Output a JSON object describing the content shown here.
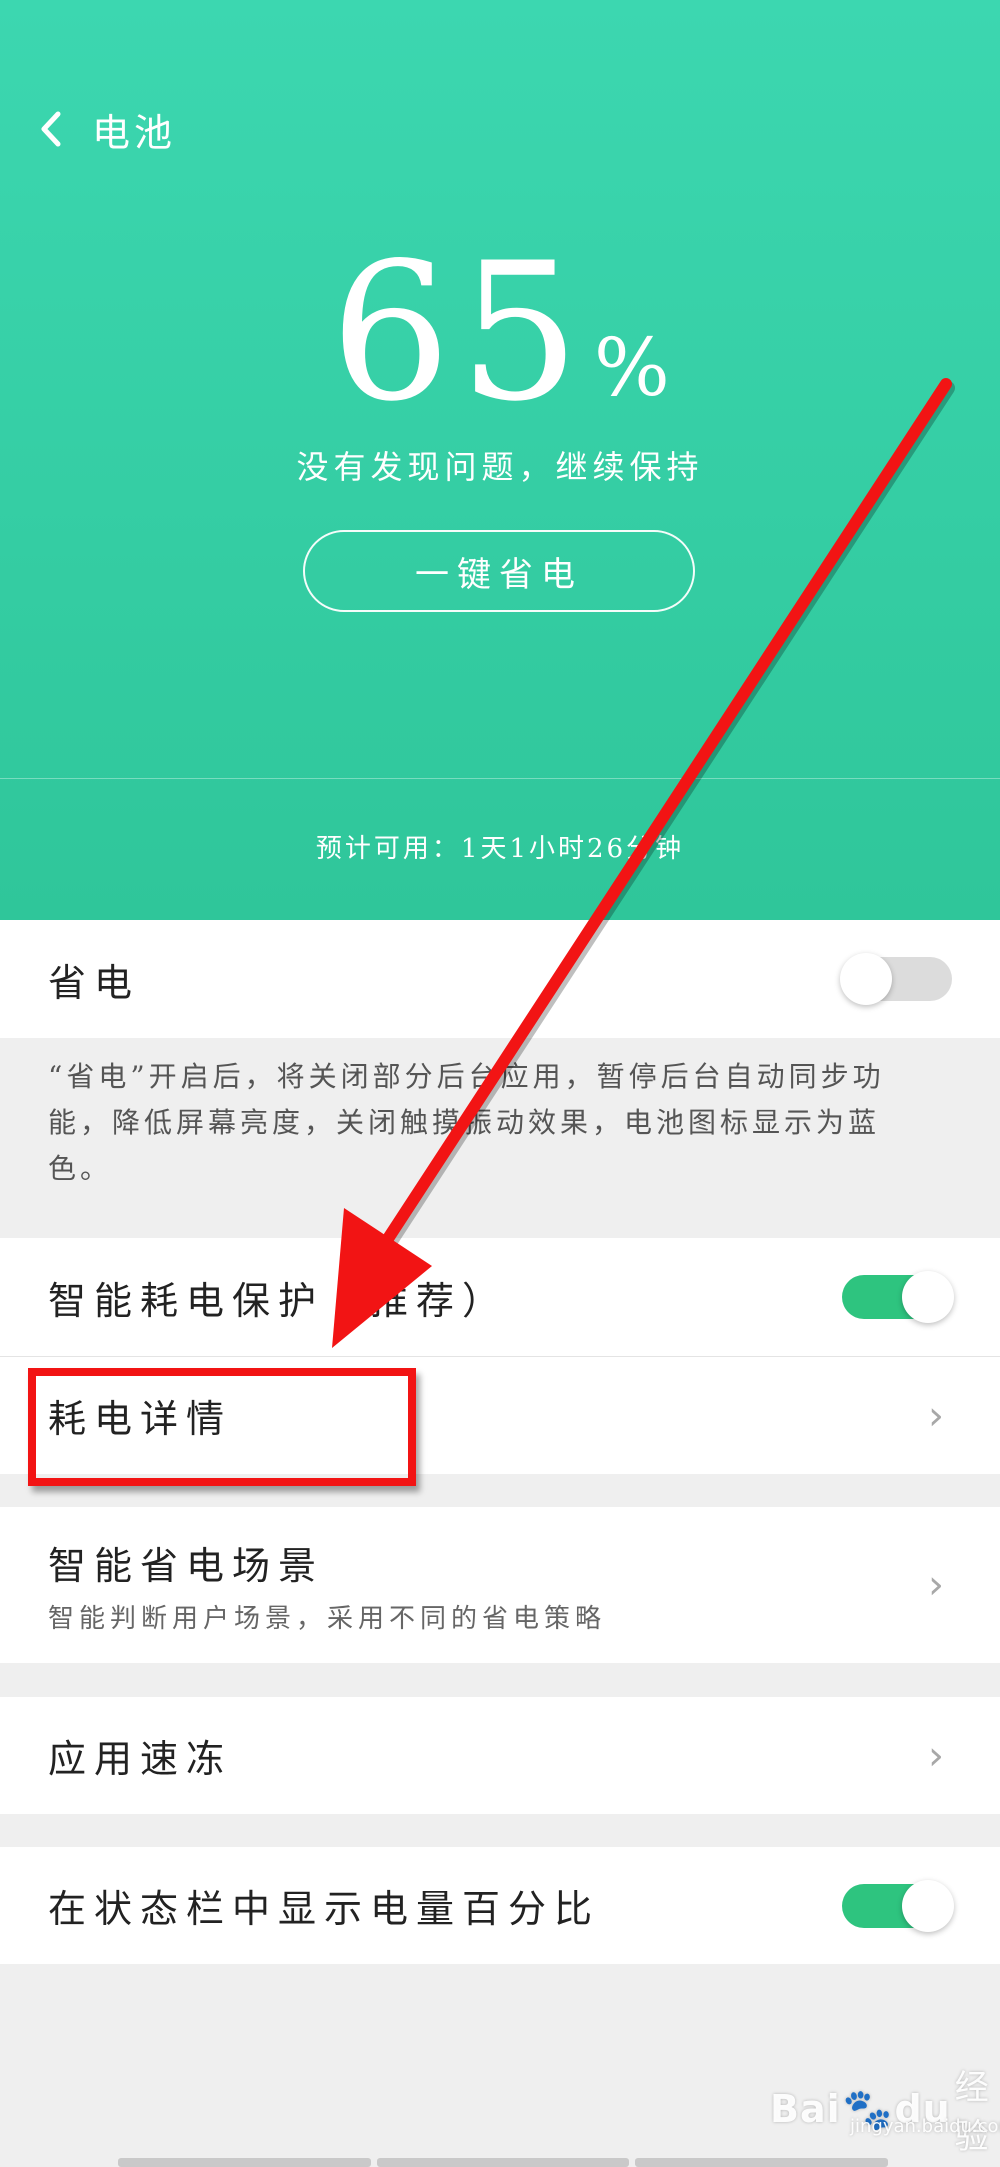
{
  "header": {
    "back_title": "电池",
    "percent_value": "65",
    "percent_sign": "%",
    "status": "没有发现问题，继续保持",
    "one_key_save": "一键省电",
    "estimate": "预计可用：1天1小时26分钟"
  },
  "settings": {
    "power_saving": {
      "label": "省电",
      "on": false
    },
    "power_saving_desc": "“省电”开启后，将关闭部分后台应用，暂停后台自动同步功能，降低屏幕亮度，关闭触摸振动效果，电池图标显示为蓝色。",
    "smart_protect": {
      "label": "智能耗电保护（推荐）",
      "on": true
    },
    "consumption_detail": {
      "label": "耗电详情"
    },
    "smart_scene": {
      "label": "智能省电场景",
      "sub": "智能判断用户场景，采用不同的省电策略"
    },
    "app_freeze": {
      "label": "应用速冻"
    },
    "status_bar_percent": {
      "label": "在状态栏中显示电量百分比",
      "on": true
    }
  },
  "watermark": {
    "brand": "Bai",
    "brand2": "du",
    "cn": "经验",
    "url": "jingyan.baidu.com"
  },
  "colors": {
    "header": "#34cfa6",
    "toggle_on": "#2ec47f",
    "annotation": "#f21414"
  }
}
